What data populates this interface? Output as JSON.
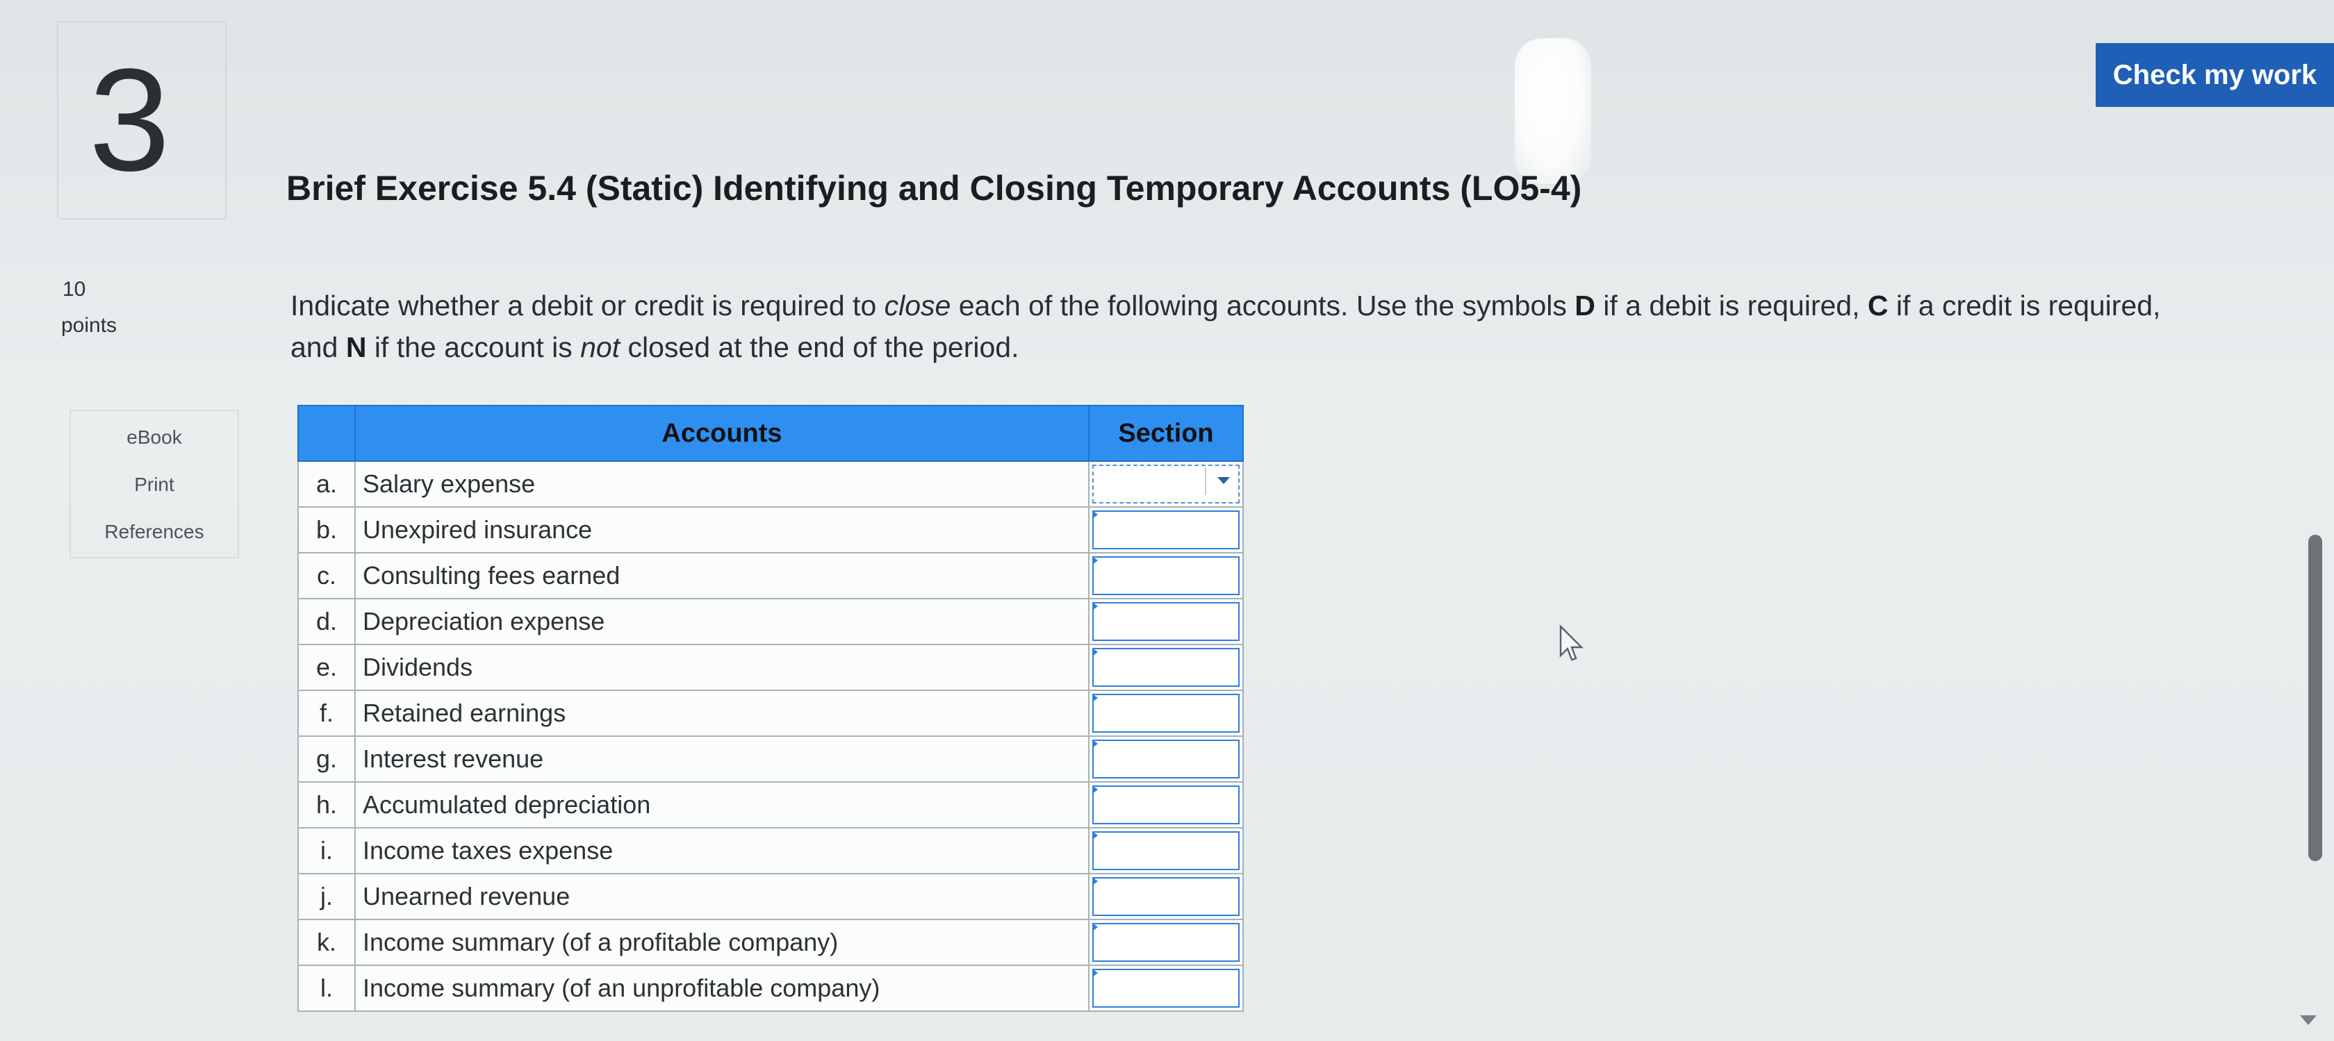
{
  "question": {
    "number": "3",
    "points_value": "10",
    "points_label": "points"
  },
  "side_links": [
    {
      "label": "eBook"
    },
    {
      "label": "Print"
    },
    {
      "label": "References"
    }
  ],
  "header": {
    "check_button": "Check my work"
  },
  "exercise": {
    "title": "Brief Exercise 5.4 (Static) Identifying and Closing Temporary Accounts (LO5-4)",
    "instructions": {
      "part1": "Indicate whether a debit or credit is required to ",
      "close": "close",
      "part2": " each of the following accounts. Use the symbols ",
      "sym_d": "D",
      "part3": " if a debit is required, ",
      "sym_c": "C",
      "part4": " if a credit is required, and ",
      "sym_n": "N",
      "part5": " if the account is ",
      "not": "not",
      "part6": " closed at the end of the period."
    }
  },
  "table": {
    "headers": {
      "letter": "",
      "accounts": "Accounts",
      "section": "Section"
    },
    "rows": [
      {
        "letter": "a.",
        "account": "Salary expense",
        "section": ""
      },
      {
        "letter": "b.",
        "account": "Unexpired insurance",
        "section": ""
      },
      {
        "letter": "c.",
        "account": "Consulting fees earned",
        "section": ""
      },
      {
        "letter": "d.",
        "account": "Depreciation expense",
        "section": ""
      },
      {
        "letter": "e.",
        "account": "Dividends",
        "section": ""
      },
      {
        "letter": "f.",
        "account": "Retained earnings",
        "section": ""
      },
      {
        "letter": "g.",
        "account": "Interest revenue",
        "section": ""
      },
      {
        "letter": "h.",
        "account": "Accumulated depreciation",
        "section": ""
      },
      {
        "letter": "i.",
        "account": "Income taxes expense",
        "section": ""
      },
      {
        "letter": "j.",
        "account": "Unearned revenue",
        "section": ""
      },
      {
        "letter": "k.",
        "account": "Income summary (of a profitable company)",
        "section": ""
      },
      {
        "letter": "l.",
        "account": "Income summary (of an unprofitable company)",
        "section": ""
      }
    ]
  },
  "colors": {
    "accent": "#1f5fb5",
    "table_header": "#2f8ff0"
  }
}
